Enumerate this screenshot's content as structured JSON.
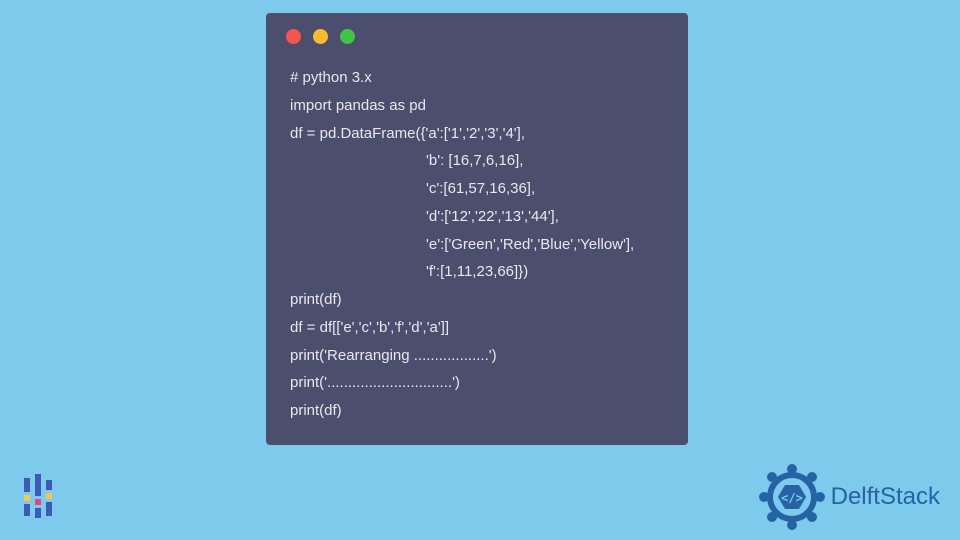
{
  "code": {
    "line1": "# python 3.x",
    "line2": "import pandas as pd",
    "line3": "df = pd.DataFrame({'a':['1','2','3','4'],",
    "line4": "'b': [16,7,6,16],",
    "line5": "'c':[61,57,16,36],",
    "line6": "'d':['12','22','13','44'],",
    "line7": "'e':['Green','Red','Blue','Yellow'],",
    "line8": "'f':[1,11,23,66]})",
    "line9": "print(df)",
    "line10": "df = df[['e','c','b','f','d','a']]",
    "line11": "print('Rearranging ..................')",
    "line12": "print('..............................')",
    "line13": "print(df)"
  },
  "brand": {
    "delftstack": "DelftStack"
  }
}
